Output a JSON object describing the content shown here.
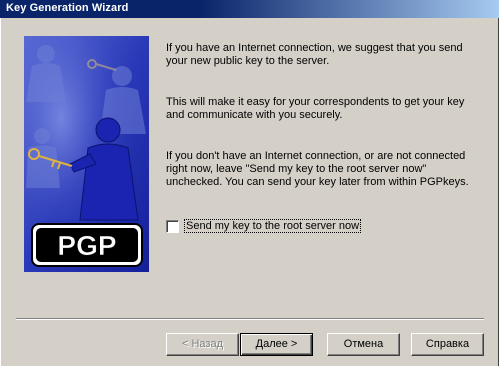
{
  "window": {
    "title": "Key Generation Wizard"
  },
  "banner": {
    "logo_text": "PGP"
  },
  "content": {
    "paragraph_1": "If you have an Internet connection, we suggest that you send your new public key to the server.",
    "paragraph_2": "This will make it easy for your correspondents to get your key and communicate with you securely.",
    "paragraph_3": "If you don't have an Internet connection, or are not connected right now, leave \"Send my key to the root server now\" unchecked.  You can send your key later from within PGPkeys."
  },
  "checkbox": {
    "label": "Send my key to the root server now",
    "checked": false
  },
  "buttons": {
    "back": "< Назад",
    "next": "Далее >",
    "cancel": "Отмена",
    "help": "Справка"
  },
  "colors": {
    "titlebar_start": "#0a246a",
    "titlebar_end": "#a6caf0",
    "dialog_bg": "#d4d0c8",
    "banner_blue": "#1d2ca8"
  }
}
